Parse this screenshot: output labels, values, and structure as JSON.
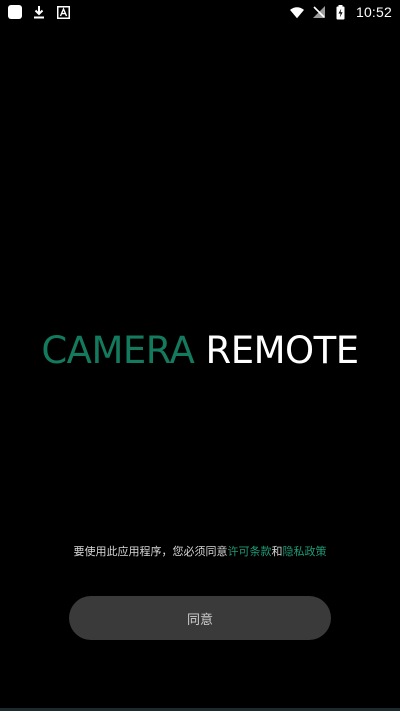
{
  "status_bar": {
    "left_icons": [
      "app-notification-icon",
      "download-icon",
      "font-a-icon"
    ],
    "right_icons": [
      "wifi-icon",
      "no-sim-icon",
      "battery-charging-icon"
    ],
    "time": "10:52"
  },
  "logo": {
    "part1": "CAMERA",
    "part2": "REMOTE",
    "part1_color": "#137a5d",
    "part2_color": "#ffffff"
  },
  "consent": {
    "prefix": "要使用此应用程序，您必须同意",
    "license_link": "许可条款",
    "conjunction": "和",
    "privacy_link": "隐私政策",
    "link_color": "#1f9a75"
  },
  "agree_button": {
    "label": "同意",
    "background": "#3a3a3a"
  }
}
